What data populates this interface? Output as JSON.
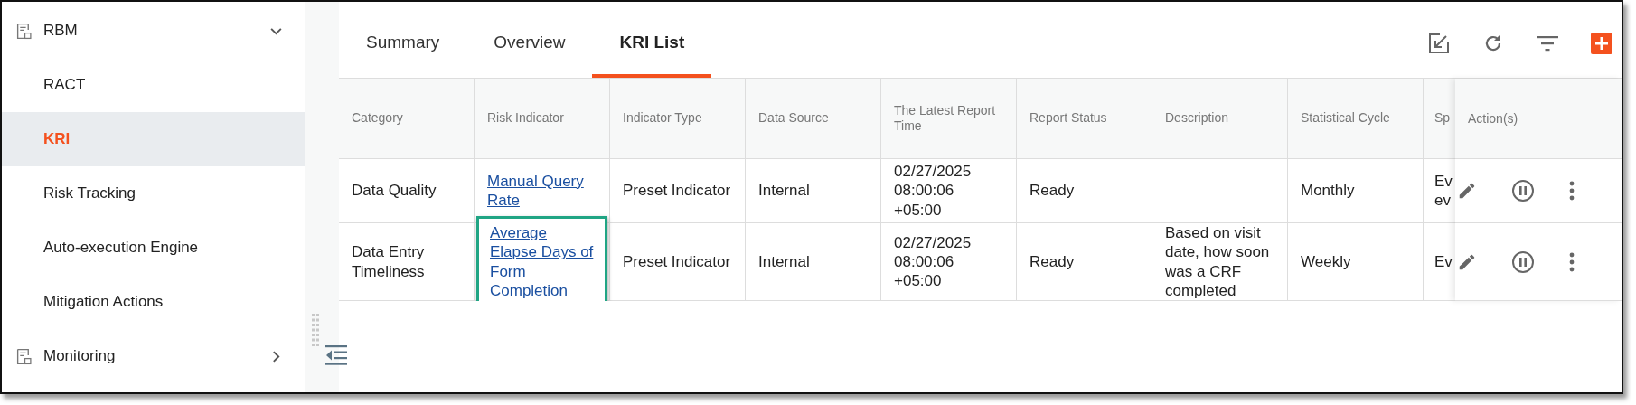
{
  "sidebar": {
    "items": [
      {
        "label": "RBM",
        "expanded": true,
        "children": [
          {
            "label": "RACT",
            "selected": false
          },
          {
            "label": "KRI",
            "selected": true
          },
          {
            "label": "Risk Tracking",
            "selected": false
          },
          {
            "label": "Auto-execution Engine",
            "selected": false
          },
          {
            "label": "Mitigation Actions",
            "selected": false
          }
        ]
      },
      {
        "label": "Monitoring",
        "expanded": false
      }
    ]
  },
  "tabs": [
    {
      "label": "Summary",
      "selected": false
    },
    {
      "label": "Overview",
      "selected": false
    },
    {
      "label": "KRI List",
      "selected": true
    }
  ],
  "table": {
    "columns": [
      "Category",
      "Risk Indicator",
      "Indicator Type",
      "Data Source",
      "The Latest Report Time",
      "Report Status",
      "Description",
      "Statistical Cycle",
      "Sp"
    ],
    "actions_column": "Action(s)",
    "rows": [
      {
        "cells": [
          "Data Quality",
          "Manual Query Rate",
          "Preset Indicator",
          "Internal",
          "02/27/2025 08:00:06 +05:00",
          "Ready",
          "",
          "Monthly",
          "Ev ev"
        ],
        "highlighted": false
      },
      {
        "cells": [
          "Data Entry Timeliness",
          "Average Elapse Days of Form Completion",
          "Preset Indicator",
          "Internal",
          "02/27/2025 08:00:06 +05:00",
          "Ready",
          "Based on visit date, how soon was a CRF completed",
          "Weekly",
          "Ev"
        ],
        "highlighted": true
      }
    ]
  }
}
